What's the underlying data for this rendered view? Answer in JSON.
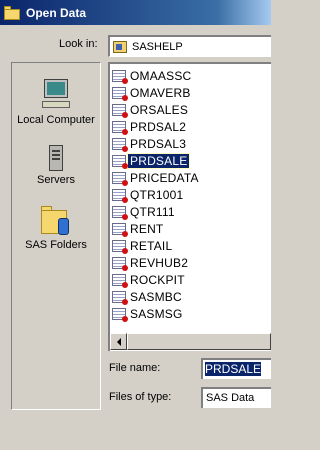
{
  "window": {
    "title": "Open Data",
    "icon": "folder-icon"
  },
  "look_in": {
    "label": "Look in:",
    "value": "SASHELP",
    "icon": "library-icon"
  },
  "places": [
    {
      "label": "Local Computer",
      "icon": "computer-icon"
    },
    {
      "label": "Servers",
      "icon": "server-icon"
    },
    {
      "label": "SAS Folders",
      "icon": "sas-folder-icon"
    }
  ],
  "files": [
    "OMAASSC",
    "OMAVERB",
    "ORSALES",
    "PRDSAL2",
    "PRDSAL3",
    "PRDSALE",
    "PRICEDATA",
    "QTR1001",
    "QTR111",
    "RENT",
    "RETAIL",
    "REVHUB2",
    "ROCKPIT",
    "SASMBC",
    "SASMSG"
  ],
  "selected_file": "PRDSALE",
  "file_name": {
    "label": "File name:",
    "value": "PRDSALE"
  },
  "file_type": {
    "label": "Files of type:",
    "value": "SAS Data"
  },
  "colors": {
    "title_bar": "#0a246a",
    "selection": "#0a246a",
    "dialog_bg": "#d4d0c8"
  }
}
